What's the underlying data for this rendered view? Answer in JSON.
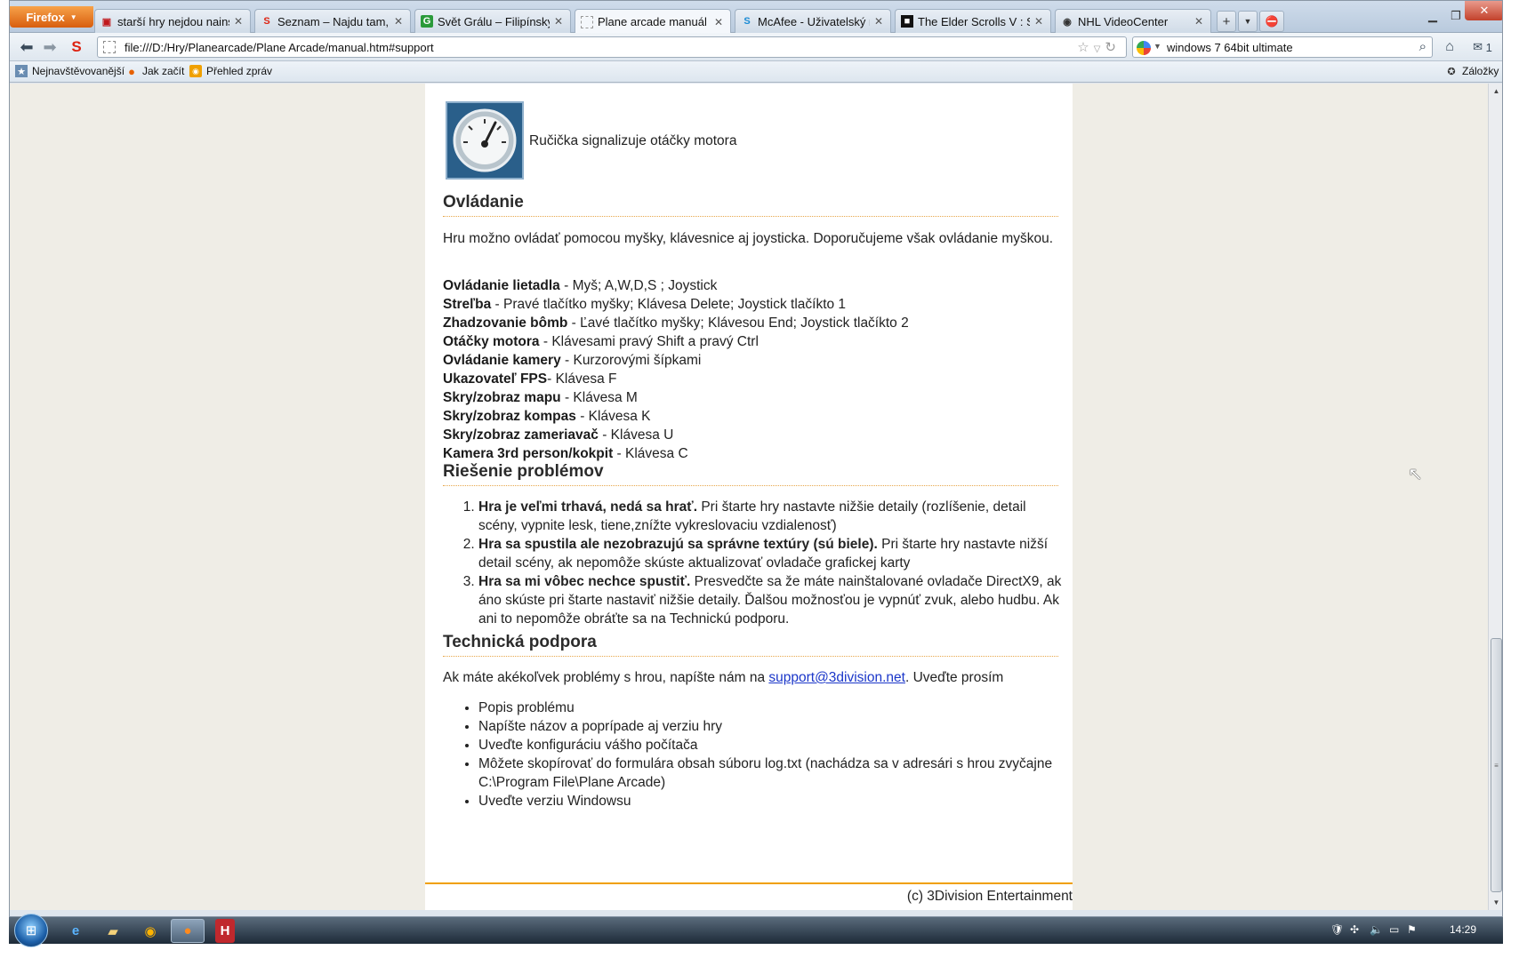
{
  "browser": {
    "app_button": "Firefox",
    "tabs": [
      {
        "label": "starší hry nejdou nainstalov...",
        "icon": "pdf-icon"
      },
      {
        "label": "Seznam – Najdu tam, co hl...",
        "icon": "seznam-icon"
      },
      {
        "label": "Svět Grálu – Filipínský léčit...",
        "icon": "gral-icon"
      },
      {
        "label": "Plane arcade manuál",
        "icon": "blank-page-icon"
      },
      {
        "label": "McAfee - Uživatelský návo...",
        "icon": "skype-icon"
      },
      {
        "label": "The Elder Scrolls V : Skyrim ...",
        "icon": "skyrim-icon"
      },
      {
        "label": "NHL VideoCenter",
        "icon": "nhl-icon"
      }
    ],
    "url": "file:///D:/Hry/Planearcade/Plane Arcade/manual.htm#support",
    "search_value": "windows 7 64bit ultimate",
    "mail_count": "1",
    "bookmarks": [
      {
        "label": "Nejnavštěvovanější",
        "icon": "star-bookmark-icon"
      },
      {
        "label": "Jak začít",
        "icon": "firefox-icon"
      },
      {
        "label": "Přehled zpráv",
        "icon": "rss-icon"
      }
    ],
    "bookmarks_menu": "Záložky"
  },
  "manual": {
    "gauge_caption": "Ručička signalizuje otáčky motora",
    "controls": {
      "heading": "Ovládanie",
      "intro": "Hru možno ovládať pomocou myšky, klávesnice aj joysticka. Doporučujeme však ovládanie myškou.",
      "items": [
        {
          "key": "Ovládanie lietadla",
          "value": " - Myš; A,W,D,S ; Joystick"
        },
        {
          "key": "Streľba",
          "value": " - Pravé tlačítko myšky; Klávesa Delete; Joystick tlačíkto 1"
        },
        {
          "key": "Zhadzovanie bômb",
          "value": " - Ľavé tlačítko myšky; Klávesou End; Joystick tlačíkto 2"
        },
        {
          "key": "Otáčky motora",
          "value": " - Klávesami pravý Shift a pravý Ctrl"
        },
        {
          "key": "Ovládanie kamery",
          "value": " - Kurzorovými šípkami"
        },
        {
          "key": "Ukazovateľ FPS",
          "value": "- Klávesa F"
        },
        {
          "key": "Skry/zobraz mapu",
          "value": " - Klávesa M"
        },
        {
          "key": "Skry/zobraz kompas",
          "value": " - Klávesa K"
        },
        {
          "key": "Skry/zobraz zameriavač",
          "value": " - Klávesa U"
        },
        {
          "key": "Kamera 3rd person/kokpit",
          "value": " - Klávesa C"
        }
      ]
    },
    "problems": {
      "heading": "Riešenie problémov",
      "items": [
        {
          "title": "Hra je veľmi trhavá, nedá sa hrať.",
          "text": " Pri štarte hry nastavte nižšie detaily (rozlíšenie, detail scény, vypnite lesk, tiene,znížte vykreslovaciu vzdialenosť)"
        },
        {
          "title": "Hra sa spustila ale nezobrazujú sa správne textúry (sú biele).",
          "text": " Pri štarte hry nastavte nižší detail scény, ak nepomôže skúste aktualizovať ovladače grafickej karty"
        },
        {
          "title": "Hra sa mi vôbec nechce spustiť.",
          "text": " Presvedčte sa že máte nainštalované ovladače DirectX9, ak áno skúste pri štarte nastaviť nižšie detaily. Ďalšou možnosťou je vypnúť zvuk, alebo hudbu. Ak ani to nepomôže obráťte sa na Technickú podporu."
        }
      ]
    },
    "support": {
      "heading": "Technická podpora",
      "intro_before": "Ak máte akékoľvek problémy s hrou, napíšte nám na ",
      "email": "support@3division.net",
      "intro_after": ". Uveďte prosím",
      "items": [
        "Popis problému",
        "Napíšte názov a poprípade aj verziu hry",
        "Uveďte konfiguráciu vášho počítača",
        "Môžete skopírovať do formulára obsah súboru log.txt (nachádza sa v adresári s hrou zvyčajne C:\\Program File\\Plane Arcade)",
        "Uveďte verziu Windowsu"
      ]
    },
    "footer": "(c) 3Division Entertainment"
  },
  "taskbar": {
    "clock": "14:29"
  },
  "colors": {
    "section_rule": "#e7a64a",
    "footer_rule": "#f0a000",
    "link": "#1a36c9",
    "page_bg": "#efede6"
  }
}
